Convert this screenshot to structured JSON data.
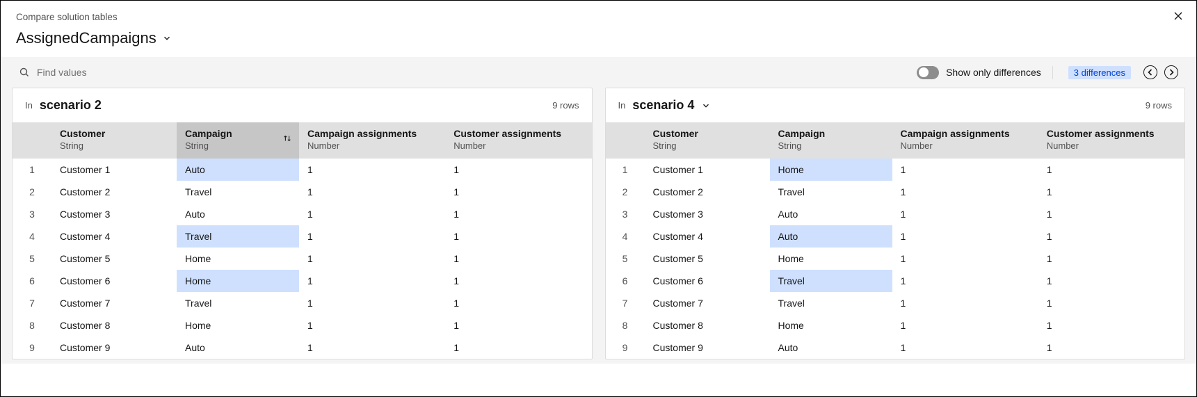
{
  "header": {
    "subtitle": "Compare solution tables",
    "title": "AssignedCampaigns"
  },
  "search": {
    "placeholder": "Find values"
  },
  "toolbar": {
    "toggle_label": "Show only differences",
    "diff_badge": "3 differences"
  },
  "columns": [
    {
      "name": "Customer",
      "type": "String"
    },
    {
      "name": "Campaign",
      "type": "String"
    },
    {
      "name": "Campaign assignments",
      "type": "Number"
    },
    {
      "name": "Customer assignments",
      "type": "Number"
    }
  ],
  "panels": {
    "left": {
      "in_label": "In",
      "name": "scenario 2",
      "row_count": "9 rows",
      "has_dropdown": false,
      "rows": [
        {
          "n": "1",
          "customer": "Customer 1",
          "campaign": "Auto",
          "ca": "1",
          "cu": "1",
          "diff": true
        },
        {
          "n": "2",
          "customer": "Customer 2",
          "campaign": "Travel",
          "ca": "1",
          "cu": "1",
          "diff": false
        },
        {
          "n": "3",
          "customer": "Customer 3",
          "campaign": "Auto",
          "ca": "1",
          "cu": "1",
          "diff": false
        },
        {
          "n": "4",
          "customer": "Customer 4",
          "campaign": "Travel",
          "ca": "1",
          "cu": "1",
          "diff": true
        },
        {
          "n": "5",
          "customer": "Customer 5",
          "campaign": "Home",
          "ca": "1",
          "cu": "1",
          "diff": false
        },
        {
          "n": "6",
          "customer": "Customer 6",
          "campaign": "Home",
          "ca": "1",
          "cu": "1",
          "diff": true
        },
        {
          "n": "7",
          "customer": "Customer 7",
          "campaign": "Travel",
          "ca": "1",
          "cu": "1",
          "diff": false
        },
        {
          "n": "8",
          "customer": "Customer 8",
          "campaign": "Home",
          "ca": "1",
          "cu": "1",
          "diff": false
        },
        {
          "n": "9",
          "customer": "Customer 9",
          "campaign": "Auto",
          "ca": "1",
          "cu": "1",
          "diff": false
        }
      ]
    },
    "right": {
      "in_label": "In",
      "name": "scenario 4",
      "row_count": "9 rows",
      "has_dropdown": true,
      "rows": [
        {
          "n": "1",
          "customer": "Customer 1",
          "campaign": "Home",
          "ca": "1",
          "cu": "1",
          "diff": true
        },
        {
          "n": "2",
          "customer": "Customer 2",
          "campaign": "Travel",
          "ca": "1",
          "cu": "1",
          "diff": false
        },
        {
          "n": "3",
          "customer": "Customer 3",
          "campaign": "Auto",
          "ca": "1",
          "cu": "1",
          "diff": false
        },
        {
          "n": "4",
          "customer": "Customer 4",
          "campaign": "Auto",
          "ca": "1",
          "cu": "1",
          "diff": true
        },
        {
          "n": "5",
          "customer": "Customer 5",
          "campaign": "Home",
          "ca": "1",
          "cu": "1",
          "diff": false
        },
        {
          "n": "6",
          "customer": "Customer 6",
          "campaign": "Travel",
          "ca": "1",
          "cu": "1",
          "diff": true
        },
        {
          "n": "7",
          "customer": "Customer 7",
          "campaign": "Travel",
          "ca": "1",
          "cu": "1",
          "diff": false
        },
        {
          "n": "8",
          "customer": "Customer 8",
          "campaign": "Home",
          "ca": "1",
          "cu": "1",
          "diff": false
        },
        {
          "n": "9",
          "customer": "Customer 9",
          "campaign": "Auto",
          "ca": "1",
          "cu": "1",
          "diff": false
        }
      ]
    }
  }
}
